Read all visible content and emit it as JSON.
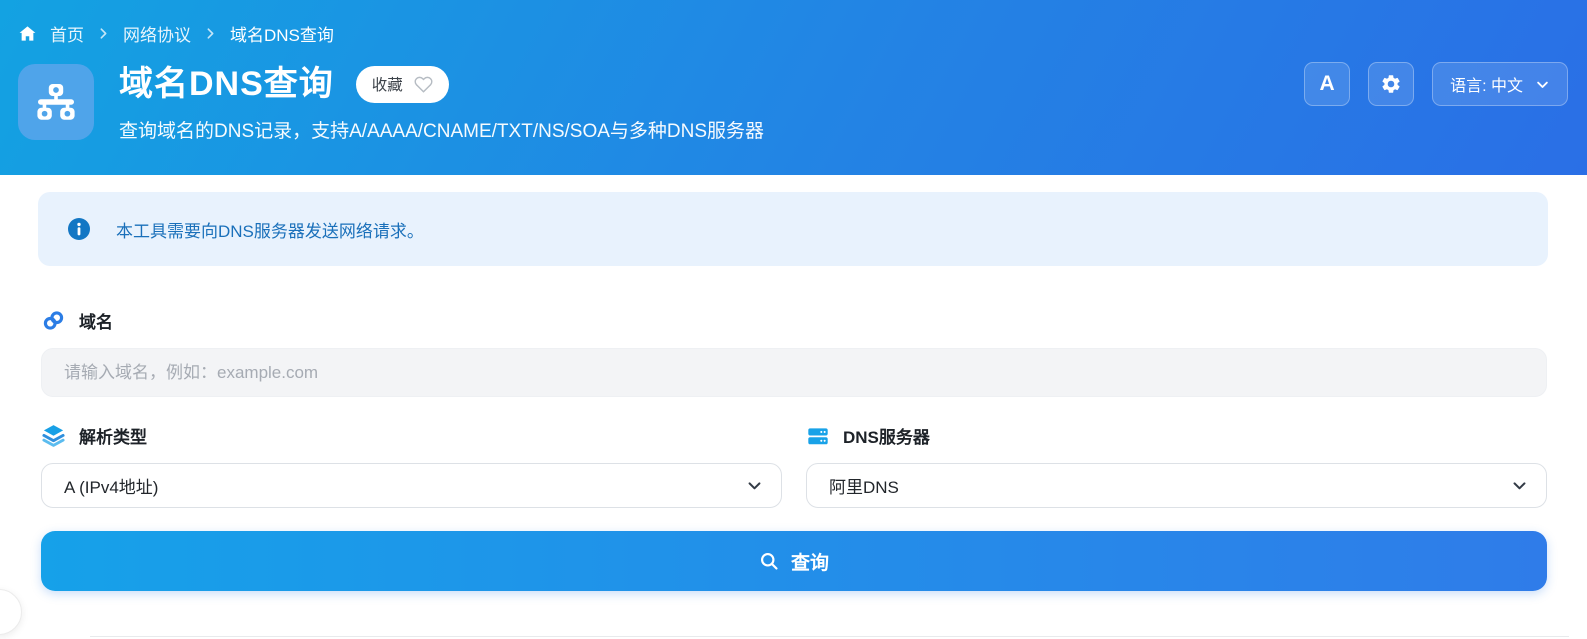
{
  "breadcrumb": {
    "home": "首页",
    "section": "网络协议",
    "current": "域名DNS查询"
  },
  "header": {
    "title": "域名DNS查询",
    "favorite_label": "收藏",
    "subtitle": "查询域名的DNS记录，支持A/AAAA/CNAME/TXT/NS/SOA与多种DNS服务器",
    "font_button_label": "A",
    "language_label": "语言: 中文"
  },
  "notice": {
    "text": "本工具需要向DNS服务器发送网络请求。"
  },
  "form": {
    "domain": {
      "label": "域名",
      "value": "",
      "placeholder": "请输入域名，例如：example.com"
    },
    "record_type": {
      "label": "解析类型",
      "selected": "A (IPv4地址)"
    },
    "dns_server": {
      "label": "DNS服务器",
      "selected": "阿里DNS"
    },
    "submit_label": "查询"
  },
  "icons": {
    "home": "home-icon",
    "breadcrumb_separator": "chevron-right-icon",
    "tool": "network-sitemap-icon",
    "favorite": "heart-icon",
    "settings": "gear-icon",
    "language_arrow": "chevron-down-icon",
    "notice": "info-icon",
    "domain": "link-icon",
    "record_type": "layers-icon",
    "dns_server": "server-icon",
    "submit": "search-icon"
  },
  "colors": {
    "header_gradient_start": "#13a2e2",
    "header_gradient_end": "#2a6fe6",
    "accent_blue": "#2e86e9",
    "notice_bg": "#e8f2fd",
    "notice_text": "#1a70ba",
    "notice_icon": "#1377c4",
    "button_gradient_start": "#16a1e9",
    "button_gradient_end": "#2f7ce9",
    "input_bg": "#f3f4f6",
    "placeholder_text": "#a6abb3"
  }
}
